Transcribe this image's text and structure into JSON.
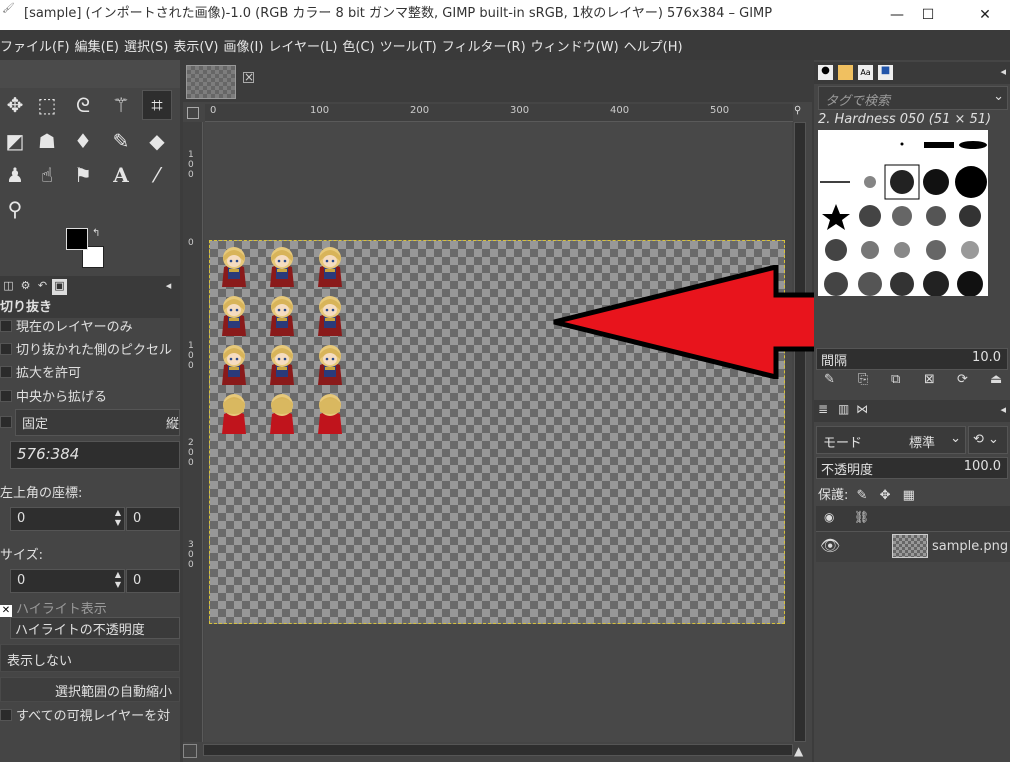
{
  "window": {
    "title": "[sample] (インポートされた画像)-1.0 (RGB カラー 8 bit ガンマ整数, GIMP built-in sRGB, 1枚のレイヤー) 576x384 – GIMP",
    "minimize": "—",
    "maximize": "☐",
    "close": "✕"
  },
  "menu": [
    "ファイル(F)",
    "編集(E)",
    "選択(S)",
    "表示(V)",
    "画像(I)",
    "レイヤー(L)",
    "色(C)",
    "ツール(T)",
    "フィルター(R)",
    "ウィンドウ(W)",
    "ヘルプ(H)"
  ],
  "tool_options": {
    "title": "切り抜き",
    "current_layer_only": "現在のレイヤーのみ",
    "delete_cropped": "切り抜かれた側のピクセル",
    "allow_grow": "拡大を許可",
    "expand_center": "中央から拡げる",
    "fixed": "固定",
    "fixed_mode": "縦",
    "ratio": "576:384",
    "position_label": "左上角の座標:",
    "pos_x": "0",
    "pos_y": "0",
    "size_label": "サイズ:",
    "size_w": "0",
    "size_h": "0",
    "highlight": "ハイライト表示",
    "highlight_opacity": "ハイライトの不透明度",
    "guides": "表示しない",
    "auto_shrink": "選択範囲の自動縮小",
    "all_visible": "すべての可視レイヤーを対"
  },
  "ruler": {
    "h_ticks": [
      "0",
      "100",
      "200",
      "300",
      "400",
      "500"
    ],
    "v_ticks": [
      "0",
      "1 0 0",
      "2 0 0",
      "3 0 0"
    ],
    "v_top": [
      "1",
      "0",
      "0"
    ]
  },
  "brushes": {
    "filter_placeholder": "タグで検索",
    "current": "2. Hardness 050 (51 × 51)",
    "spacing_label": "間隔",
    "spacing_value": "10.0"
  },
  "layers": {
    "mode_label": "モード",
    "mode_value": "標準",
    "opacity_label": "不透明度",
    "opacity_value": "100.0",
    "lock_label": "保護:",
    "layer_name": "sample.png"
  },
  "colors": {
    "arrow": "#e8141c",
    "selection": "#d8c23a"
  }
}
